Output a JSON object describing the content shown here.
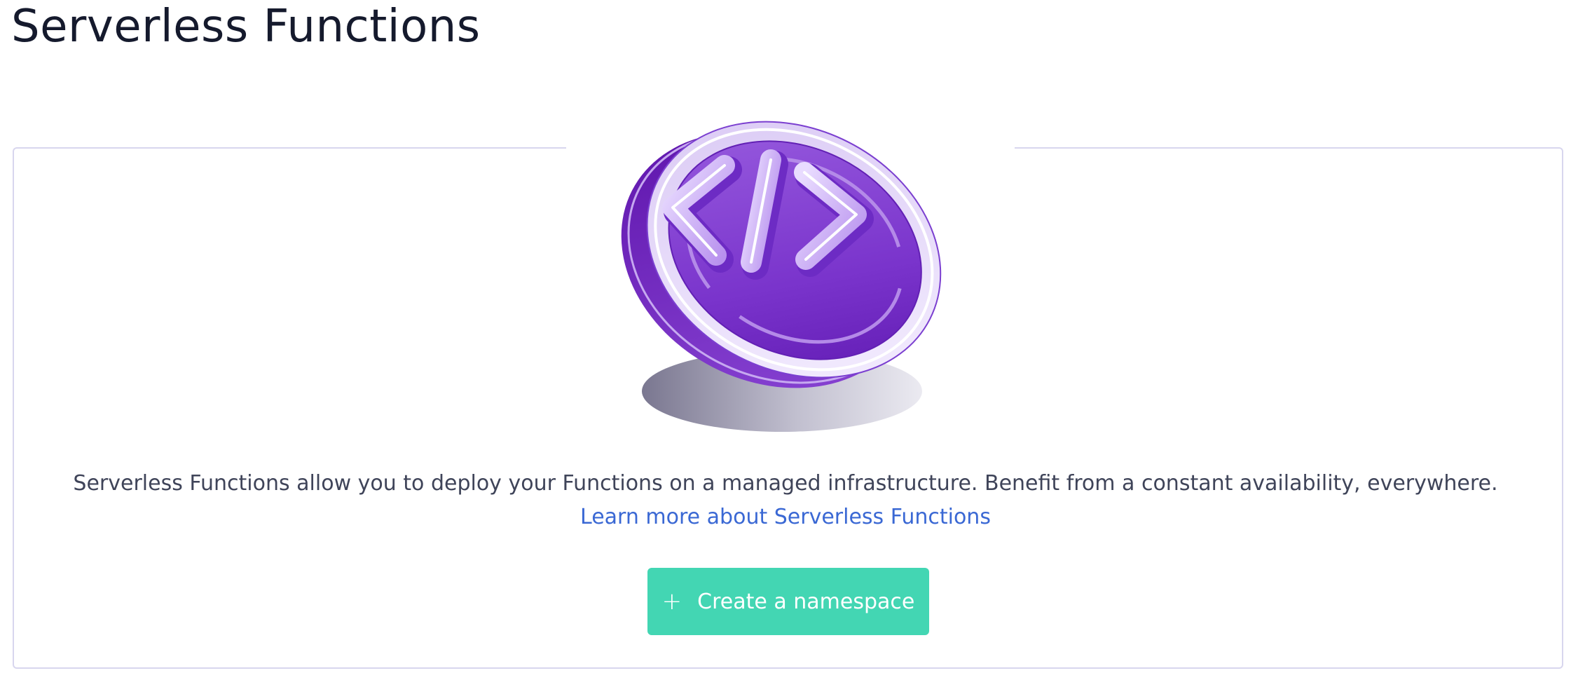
{
  "page": {
    "title": "Serverless Functions"
  },
  "empty_state": {
    "illustration_icon": "code-coin-icon",
    "description": "Serverless Functions allow you to deploy your Functions on a managed infrastructure. Benefit from a constant availability, everywhere.",
    "learn_more_label": "Learn more about Serverless Functions",
    "create_button": {
      "icon": "plus-icon",
      "icon_glyph": "+",
      "label": "Create a namespace"
    }
  },
  "colors": {
    "title": "#151a2d",
    "border": "#d8d6ee",
    "text": "#3f4459",
    "link": "#3a68d4",
    "primary_button": "#43d6b3",
    "brand_purple": "#6b2fc2"
  }
}
